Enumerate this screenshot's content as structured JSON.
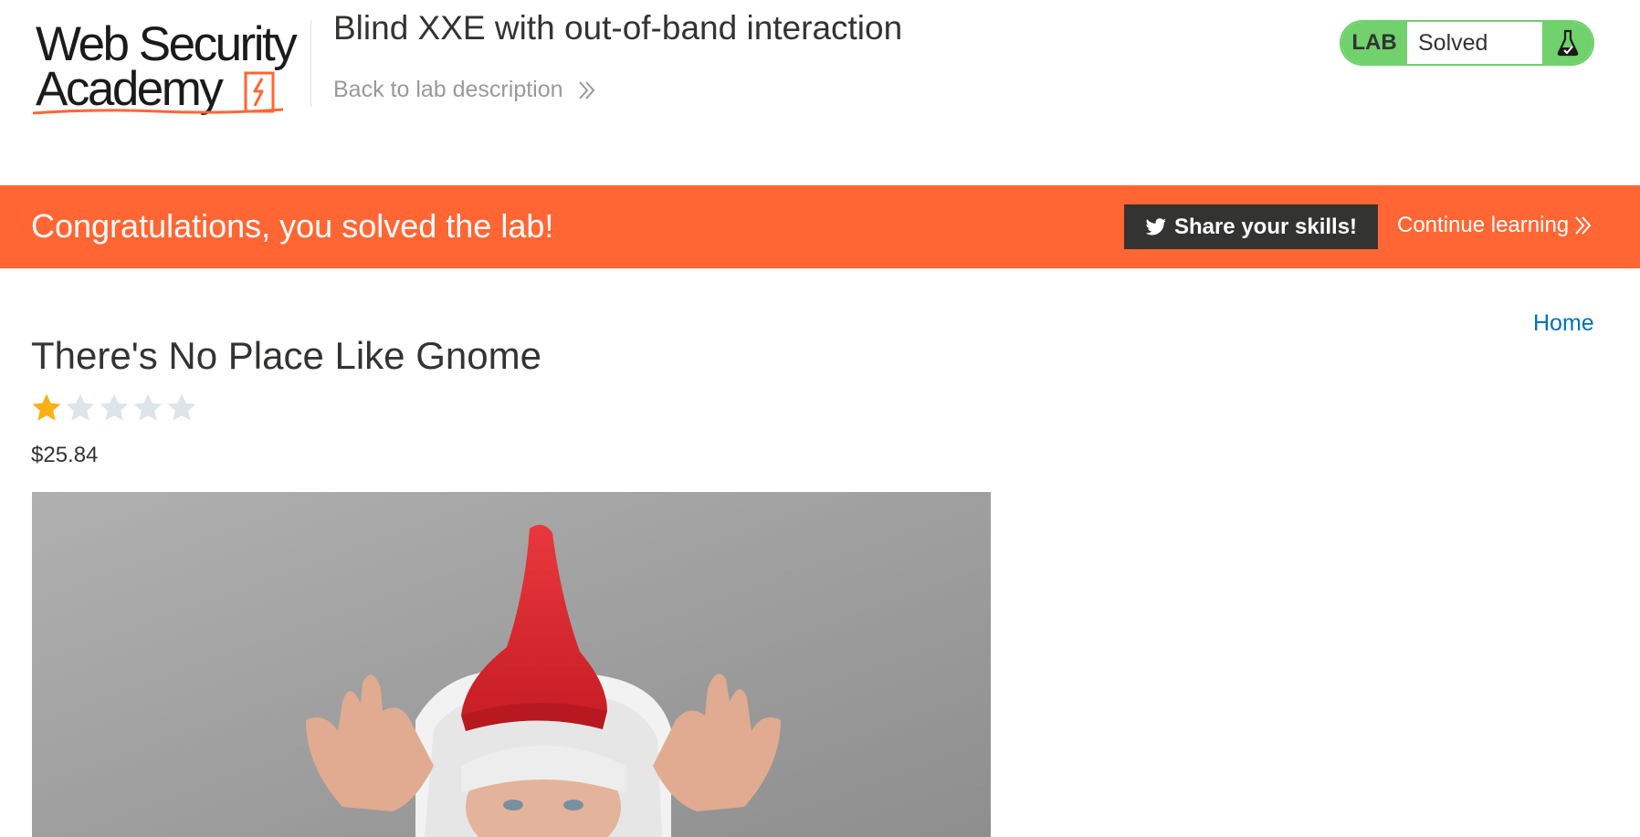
{
  "header": {
    "logo": {
      "line1": "Web Security",
      "line2": "Academy"
    },
    "lab_title": "Blind XXE with out-of-band interaction",
    "back_link_label": "Back to lab description",
    "status": {
      "tag": "LAB",
      "text": "Solved",
      "icon": "flask-icon"
    }
  },
  "banner": {
    "message": "Congratulations, you solved the lab!",
    "share_label": "Share your skills!",
    "share_icon": "twitter-icon",
    "continue_label": "Continue learning"
  },
  "nav": {
    "home_label": "Home"
  },
  "product": {
    "title": "There's No Place Like Gnome",
    "rating": {
      "value": 1,
      "max": 5
    },
    "price": "$25.84",
    "image": "gnome-photo"
  },
  "colors": {
    "accent": "#ff6633",
    "solved_green": "#70d16d",
    "dark": "#333332",
    "link_blue": "#0071bc",
    "star_filled": "#fbb016",
    "star_empty": "#dde5ea"
  }
}
